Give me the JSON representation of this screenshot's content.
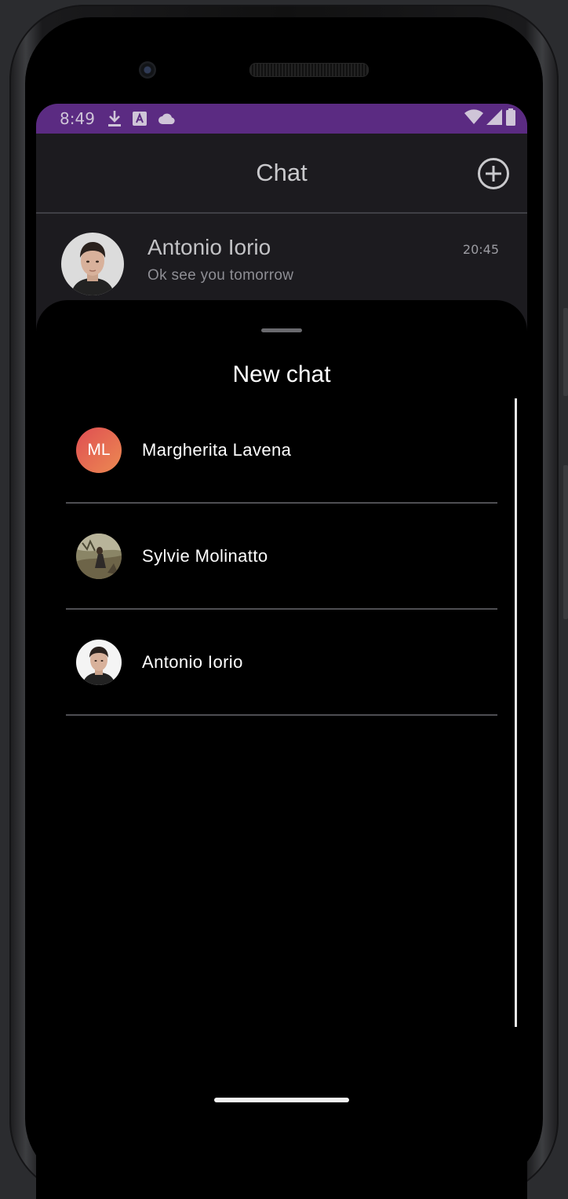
{
  "status_bar": {
    "time": "8:49",
    "icons": [
      "download-icon",
      "a-icon",
      "cloud-icon"
    ],
    "right_icons": [
      "wifi-icon",
      "signal-icon",
      "battery-icon"
    ],
    "color": "#5b2b82"
  },
  "app_bar": {
    "title": "Chat",
    "action_icon": "add-circle-icon"
  },
  "chats": [
    {
      "name": "Antonio Iorio",
      "preview": "Ok see you tomorrow",
      "time": "20:45",
      "avatar": "photo"
    }
  ],
  "sheet": {
    "title": "New chat",
    "contacts": [
      {
        "name": "Margherita Lavena",
        "initials": "ML",
        "avatar": "initials"
      },
      {
        "name": "Sylvie Molinatto",
        "avatar": "photo"
      },
      {
        "name": "Antonio Iorio",
        "avatar": "photo"
      }
    ]
  },
  "colors": {
    "background": "#1c1b1f",
    "sheet": "#000000",
    "accent": "#5b2b82",
    "initials_gradient": [
      "#df4e52",
      "#ec8a52"
    ]
  }
}
